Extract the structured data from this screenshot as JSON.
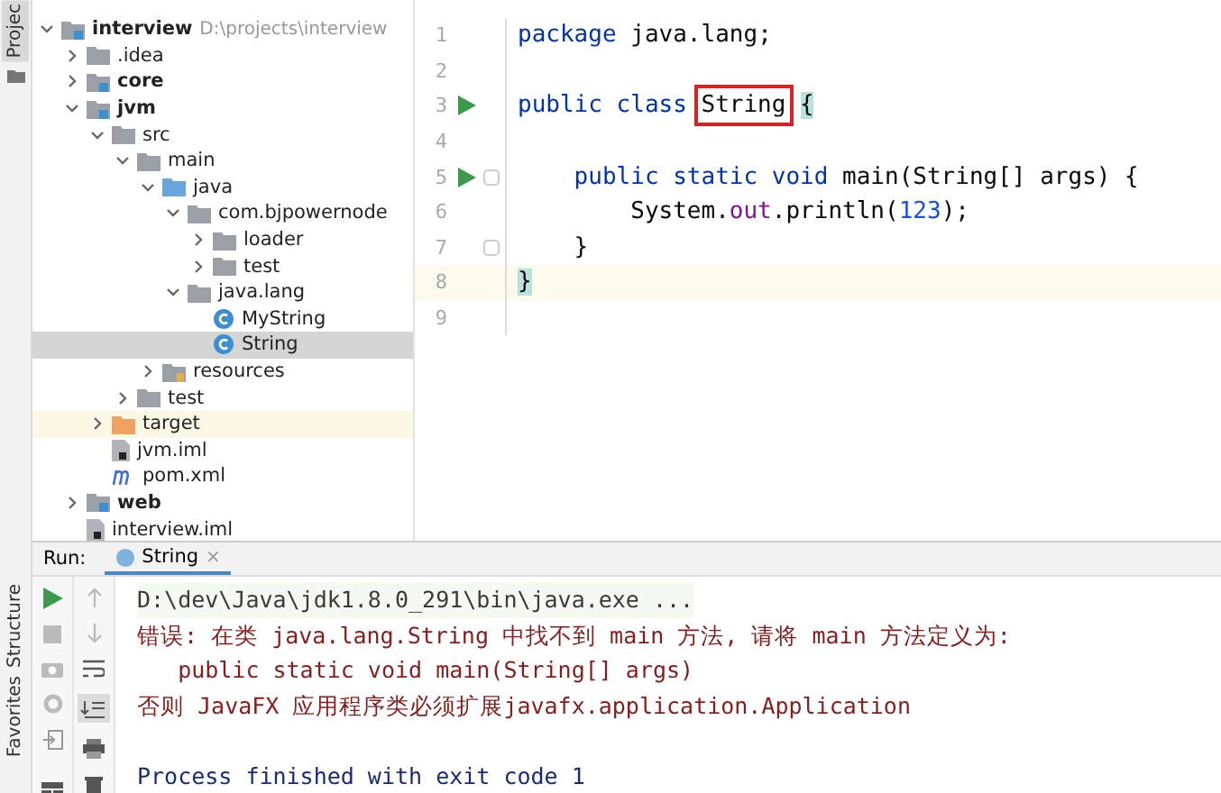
{
  "side_strip": {
    "top_tab": "Projec",
    "bottom_tabs": [
      "Structure",
      "Favorites"
    ]
  },
  "project_tree": [
    {
      "label": "interview",
      "hint": "D:\\projects\\interview",
      "kind": "module",
      "expanded": true,
      "selected": false,
      "children": [
        {
          "label": ".idea",
          "kind": "folder",
          "expanded": false,
          "selected": false
        },
        {
          "label": "core",
          "kind": "module",
          "expanded": false,
          "selected": false
        },
        {
          "label": "jvm",
          "kind": "module",
          "expanded": true,
          "selected": false,
          "children": [
            {
              "label": "src",
              "kind": "folder",
              "expanded": true,
              "selected": false,
              "children": [
                {
                  "label": "main",
                  "kind": "folder",
                  "expanded": true,
                  "selected": false,
                  "children": [
                    {
                      "label": "java",
                      "kind": "source-folder",
                      "expanded": true,
                      "selected": false,
                      "children": [
                        {
                          "label": "com.bjpowernode",
                          "kind": "package",
                          "expanded": true,
                          "selected": false,
                          "children": [
                            {
                              "label": "loader",
                              "kind": "package",
                              "expanded": false,
                              "selected": false
                            },
                            {
                              "label": "test",
                              "kind": "package",
                              "expanded": false,
                              "selected": false
                            }
                          ]
                        },
                        {
                          "label": "java.lang",
                          "kind": "package",
                          "expanded": true,
                          "selected": false,
                          "children": [
                            {
                              "label": "MyString",
                              "kind": "class",
                              "selected": false
                            },
                            {
                              "label": "String",
                              "kind": "class",
                              "selected": true
                            }
                          ]
                        }
                      ]
                    },
                    {
                      "label": "resources",
                      "kind": "resources-folder",
                      "expanded": false,
                      "selected": false
                    }
                  ]
                },
                {
                  "label": "test",
                  "kind": "folder",
                  "expanded": false,
                  "selected": false
                }
              ]
            },
            {
              "label": "target",
              "kind": "excluded-folder",
              "expanded": false,
              "selected": false
            },
            {
              "label": "jvm.iml",
              "kind": "file",
              "selected": false
            },
            {
              "label": "pom.xml",
              "kind": "maven",
              "selected": false
            }
          ]
        },
        {
          "label": "web",
          "kind": "module",
          "expanded": false,
          "selected": false
        },
        {
          "label": "interview.iml",
          "kind": "file",
          "selected": false
        }
      ]
    }
  ],
  "editor": {
    "lines": [
      {
        "number": "1",
        "run": false,
        "fold": false,
        "current": false,
        "tokens": [
          {
            "kind": "keyword",
            "text": "package"
          },
          {
            "kind": "plain",
            "text": " java.lang;"
          }
        ]
      },
      {
        "number": "2",
        "run": false,
        "fold": false,
        "current": false
      },
      {
        "number": "3",
        "run": true,
        "fold": false,
        "current": false,
        "tokens": [
          {
            "kind": "keyword",
            "text": "public class "
          },
          {
            "kind": "boxed",
            "text": "String"
          },
          {
            "kind": "brace",
            "text": "{"
          }
        ]
      },
      {
        "number": "4",
        "run": false,
        "fold": false,
        "current": false
      },
      {
        "number": "5",
        "run": true,
        "fold": true,
        "current": false,
        "tokens": [
          {
            "kind": "keyword",
            "text": "    public static void "
          },
          {
            "kind": "plain",
            "text": "main(String[] args) {"
          }
        ]
      },
      {
        "number": "6",
        "run": false,
        "fold": false,
        "current": false,
        "tokens": [
          {
            "kind": "plain",
            "text": "        System."
          },
          {
            "kind": "field",
            "text": "out"
          },
          {
            "kind": "plain",
            "text": ".println("
          },
          {
            "kind": "number",
            "text": "123"
          },
          {
            "kind": "plain",
            "text": ");"
          }
        ]
      },
      {
        "number": "7",
        "run": false,
        "fold": true,
        "current": false,
        "tokens": [
          {
            "kind": "plain",
            "text": "    }"
          }
        ]
      },
      {
        "number": "8",
        "run": false,
        "fold": false,
        "current": true,
        "tokens": [
          {
            "kind": "brace",
            "text": "}"
          }
        ]
      },
      {
        "number": "9",
        "run": false,
        "fold": false,
        "current": false
      }
    ]
  },
  "run_panel": {
    "label": "Run:",
    "tab": "String",
    "tab_close": "×",
    "console": [
      {
        "kind": "command",
        "text": "D:\\dev\\Java\\jdk1.8.0_291\\bin\\java.exe ..."
      },
      {
        "kind": "error",
        "text": "错误: 在类 java.lang.String 中找不到 main 方法, 请将 main 方法定义为:"
      },
      {
        "kind": "error",
        "text": "   public static void main(String[] args)"
      },
      {
        "kind": "error",
        "text": "否则 JavaFX 应用程序类必须扩展javafx.application.Application"
      },
      {
        "kind": "exit",
        "text": "Process finished with exit code 1"
      }
    ]
  }
}
